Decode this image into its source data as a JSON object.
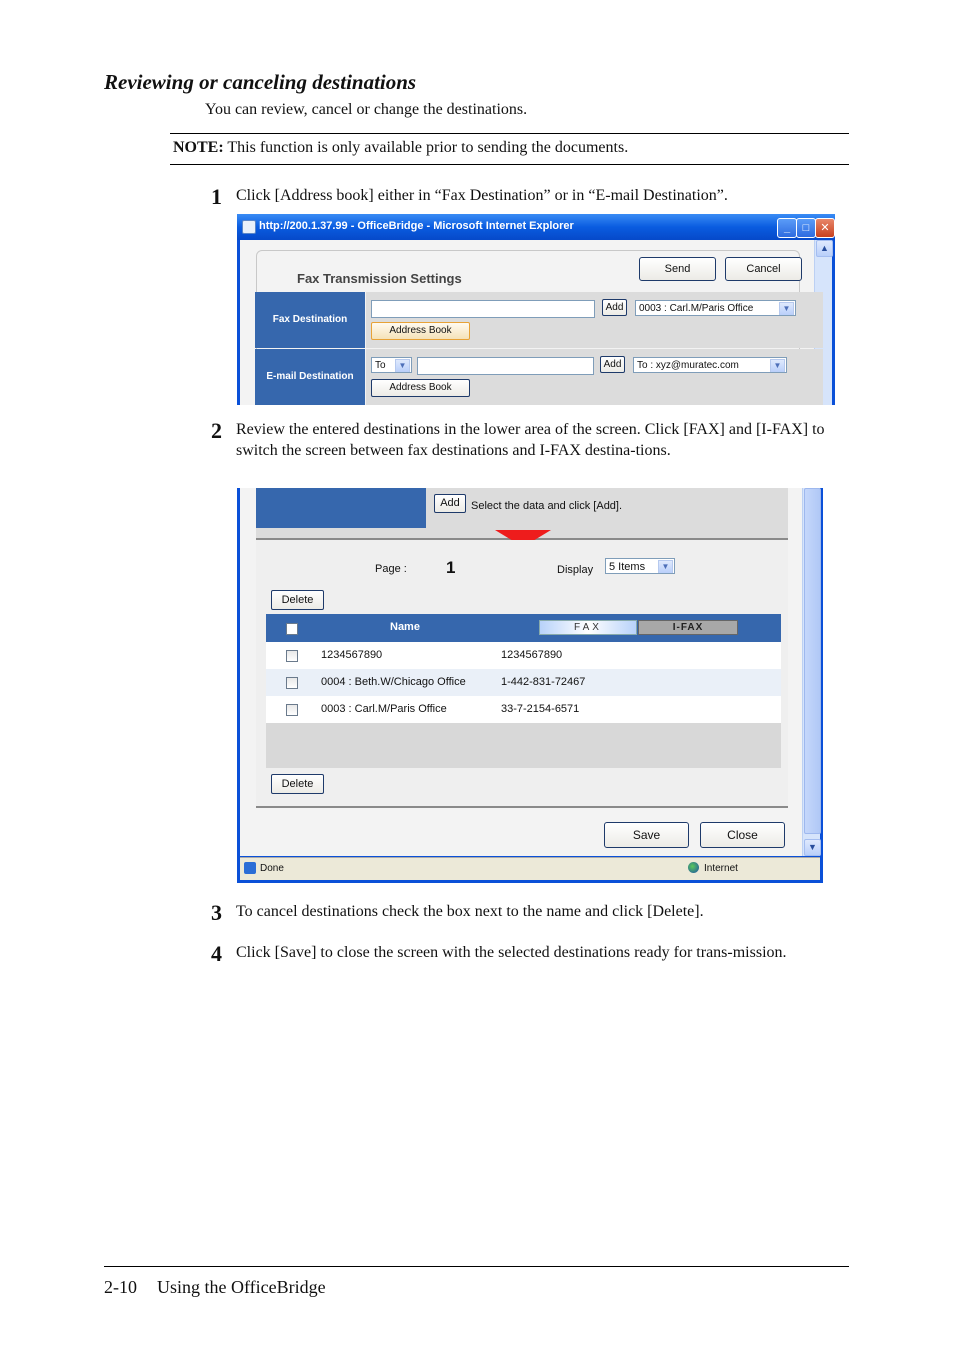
{
  "heading": "Reviewing or canceling destinations",
  "intro": "You can review, cancel or change the destinations.",
  "note": {
    "label": "NOTE:",
    "text": " This function is only available prior to sending the documents."
  },
  "steps": [
    {
      "number": "1",
      "text": "Click [Address book] either in “Fax Destination” or in “E-mail Destination”."
    },
    {
      "number": "2",
      "text": "Review the entered destinations in the lower area of the screen. Click [FAX] and [I-FAX] to switch the screen between fax destinations and I-FAX destina-tions."
    },
    {
      "number": "3",
      "text": "To cancel destinations check the box next to the name and click [Delete]."
    },
    {
      "number": "4",
      "text": "Click [Save] to close the screen with the selected destinations ready for trans-mission."
    }
  ],
  "screenshot1": {
    "window_title": "http://200.1.37.99 - OfficeBridge - Microsoft Internet Explorer",
    "window_controls": {
      "minimize": "_",
      "maximize": "□",
      "close": "✕"
    },
    "page_title": "Fax Transmission Settings",
    "send_label": "Send",
    "cancel_label": "Cancel",
    "fax_destination": {
      "label": "Fax Destination",
      "input_value": "",
      "add_label": "Add",
      "selected": "0003 : Carl.M/Paris Office",
      "address_book_label": "Address Book"
    },
    "email_destination": {
      "label": "E-mail Destination",
      "type_selected": "To",
      "input_value": "",
      "add_label": "Add",
      "selected": "To : xyz@muratec.com",
      "address_book_label": "Address Book"
    }
  },
  "screenshot2": {
    "add_label": "Add",
    "add_hint": "Select the data and click [Add].",
    "page_label": "Page :",
    "page_number": "1",
    "display_label": "Display",
    "display_selected": "5 Items",
    "delete_label": "Delete",
    "table": {
      "name_header": "Name",
      "tabs": [
        {
          "label": "FAX",
          "active": true
        },
        {
          "label": "I-FAX",
          "active": false
        }
      ],
      "rows": [
        {
          "name": "1234567890",
          "number": "1234567890"
        },
        {
          "name": "0004 : Beth.W/Chicago Office",
          "number": "1-442-831-72467"
        },
        {
          "name": "0003 : Carl.M/Paris Office",
          "number": "33-7-2154-6571"
        }
      ]
    },
    "save_label": "Save",
    "close_label": "Close",
    "status_text": "Done",
    "zone_text": "Internet"
  },
  "footer": {
    "page_number": "2-10",
    "section": "Using the OfficeBridge"
  },
  "colors": {
    "header_blue": "#3667ad",
    "xp_titlebar": "#0a5ce0",
    "arrow_red": "#ee1c1c"
  }
}
